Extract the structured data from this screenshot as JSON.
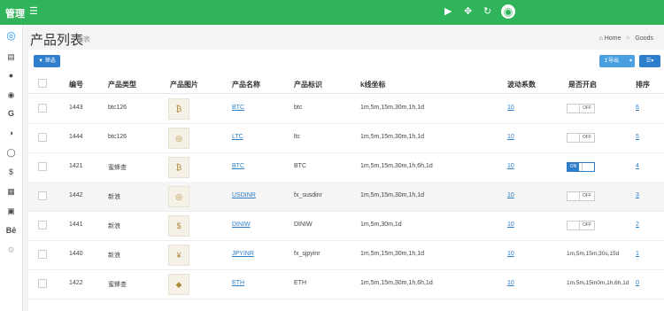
{
  "app": {
    "brand": "管理"
  },
  "topbar": {
    "menu_icon": "menu-icon",
    "icons": [
      "play-icon",
      "expand-icon",
      "refresh-icon",
      "user-avatar"
    ]
  },
  "sidebar": {
    "icons": [
      "dashboard-icon",
      "chart-icon",
      "user-icon",
      "circle-icon",
      "g-icon",
      "half-circle-icon",
      "ring-icon",
      "dollar-icon",
      "calculator-icon",
      "image-icon",
      "be-icon",
      "gear-icon"
    ]
  },
  "page": {
    "title": "产品列表",
    "subtitle": "列表"
  },
  "breadcrumb": {
    "home": "Home",
    "current": "Goods"
  },
  "toolbar": {
    "filter_label": "筛选",
    "export_label": "导出"
  },
  "table": {
    "headers": [
      "编号",
      "产品类型",
      "产品图片",
      "产品名称",
      "产品标识",
      "k线坐标",
      "波动系数",
      "是否开启",
      "排序"
    ],
    "rows": [
      {
        "id": "1443",
        "type": "btc126",
        "name": "BTC",
        "symbol": "btc",
        "kline": "1m,5m,15m,30m,1h,1d",
        "coef": "10",
        "open_state": "OFF",
        "sort": "6",
        "image": "bitcoin-coin-icon"
      },
      {
        "id": "1444",
        "type": "btc126",
        "name": "LTC",
        "symbol": "ltc",
        "kline": "1m,5m,15m,30m,1h,1d",
        "coef": "10",
        "open_state": "OFF",
        "sort": "5",
        "image": "coins-icon"
      },
      {
        "id": "1421",
        "type": "蜜蜂查",
        "name": "BTC",
        "symbol": "BTC",
        "kline": "1m,5m,15m,30m,1h,6h,1d",
        "coef": "10",
        "open_state": "ON",
        "sort": "4",
        "image": "bitcoin-coin-icon"
      },
      {
        "id": "1442",
        "type": "新浪",
        "name": "USDINR",
        "symbol": "fx_susdinr",
        "kline": "1m,5m,15m,30m,1h,1d",
        "coef": "10",
        "open_state": "OFF",
        "sort": "3",
        "image": "coins-icon"
      },
      {
        "id": "1441",
        "type": "新浪",
        "name": "DINIW",
        "symbol": "DINIW",
        "kline": "1m,5m,30m,1d",
        "coef": "10",
        "open_state": "OFF",
        "sort": "2",
        "image": "dollar-coin-icon"
      },
      {
        "id": "1440",
        "type": "新浪",
        "name": "JPYINR",
        "symbol": "fx_sjpyinr",
        "kline": "1m,5m,15m,30m,1h,1d",
        "coef": "10",
        "open_state": "1m,5m,15m,30s,15d",
        "sort": "1",
        "image": "yen-coin-icon"
      },
      {
        "id": "1422",
        "type": "蜜蜂查",
        "name": "ETH",
        "symbol": "ETH",
        "kline": "1m,5m,15m,30m,1h,6h,1d",
        "coef": "10",
        "open_state": "1m,5m,15m0m,1h,6h,1d",
        "sort": "0",
        "image": "ethereum-coin-icon"
      }
    ]
  },
  "colors": {
    "topbar": "#2fb45a",
    "primary": "#2d7ecb",
    "export": "#4aa0e0"
  }
}
